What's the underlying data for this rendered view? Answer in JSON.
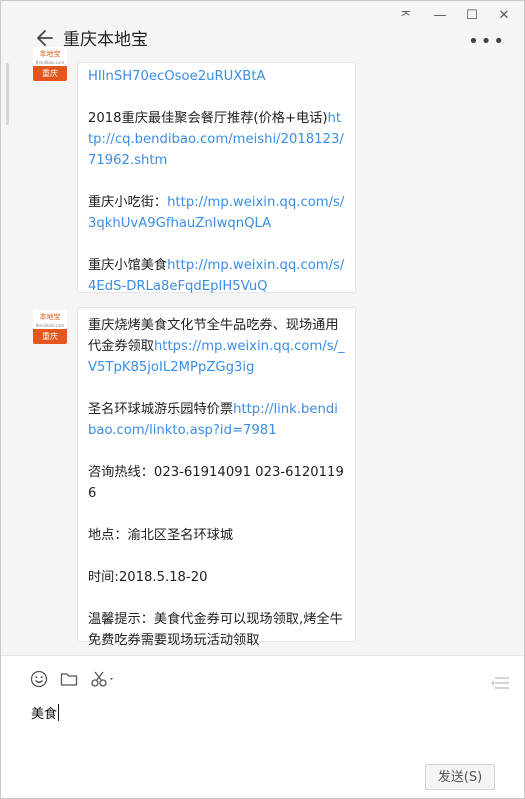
{
  "window": {
    "controls": [
      "ᅎ",
      "—",
      "☐",
      "✕"
    ],
    "title": "重庆本地宝"
  },
  "avatar": {
    "brand": "本地宝",
    "sub": "Bendibao.com",
    "city": "重庆"
  },
  "messages": [
    {
      "paragraphs": [
        {
          "parts": [
            {
              "type": "link",
              "text": "HIlnSH70ecOsoe2uRUXBtA"
            }
          ]
        },
        {
          "parts": [
            {
              "type": "text",
              "text": "2018重庆最佳聚会餐厅推荐(价格+电话)"
            },
            {
              "type": "link",
              "text": "http://cq.bendibao.com/meishi/2018123/71962.shtm"
            }
          ]
        },
        {
          "parts": [
            {
              "type": "text",
              "text": "重庆小吃街："
            },
            {
              "type": "link",
              "text": "http://mp.weixin.qq.com/s/3qkhUvA9GfhauZnIwqnQLA"
            }
          ]
        },
        {
          "parts": [
            {
              "type": "text",
              "text": "重庆小馆美食"
            },
            {
              "type": "link",
              "text": "http://mp.weixin.qq.com/s/4EdS-DRLa8eFqdEpIH5VuQ"
            }
          ]
        }
      ]
    },
    {
      "paragraphs": [
        {
          "parts": [
            {
              "type": "text",
              "text": "重庆烧烤美食文化节全牛品吃券、现场通用代金券领取"
            },
            {
              "type": "link",
              "text": "https://mp.weixin.qq.com/s/_V5TpK85joIL2MPpZGg3ig"
            }
          ]
        },
        {
          "parts": [
            {
              "type": "text",
              "text": "圣名环球城游乐园特价票"
            },
            {
              "type": "link",
              "text": "http://link.bendibao.com/linkto.asp?id=7981"
            }
          ]
        },
        {
          "parts": [
            {
              "type": "text",
              "text": "咨询热线：023-61914091  023-61201196"
            }
          ]
        },
        {
          "parts": [
            {
              "type": "text",
              "text": "地点：渝北区圣名环球城"
            }
          ]
        },
        {
          "parts": [
            {
              "type": "text",
              "text": "时间:2018.5.18-20"
            }
          ]
        },
        {
          "parts": [
            {
              "type": "text",
              "text": "温馨提示：美食代金券可以现场领取,烤全牛免费吃券需要现场玩活动领取"
            }
          ]
        }
      ]
    }
  ],
  "composer": {
    "typed_text": "美食",
    "send_label": "发送(S)"
  }
}
